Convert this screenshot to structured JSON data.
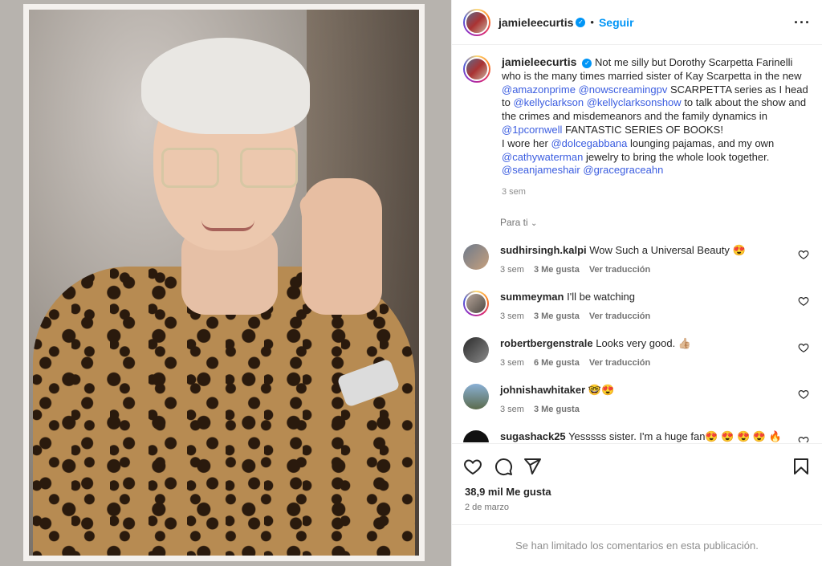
{
  "post": {
    "username": "jamieleecurtis",
    "verified": true,
    "follow_label": "Seguir",
    "caption_parts": {
      "p1": "Not me silly but Dorothy Scarpetta Farinelli who is the many times married sister of Kay Scarpetta in the new",
      "m1": "@amazonprime",
      "m2": "@nowscreamingpv",
      "p2": "SCARPETTA series as I head to",
      "m3": "@kellyclarkson",
      "m4": "@kellyclarksonshow",
      "p3": "to talk about the show and the crimes and misdemeanors and the family dynamics in",
      "m5": "@1pcornwell",
      "p4": "FANTASTIC SERIES OF BOOKS!",
      "p5": "I wore her",
      "m6": "@dolcegabbana",
      "p6": "lounging pajamas, and my own",
      "m7": "@cathywaterman",
      "p7": "jewelry to bring the whole look together.",
      "m8": "@seanjameshair",
      "m9": "@gracegraceahn"
    },
    "caption_time": "3 sem",
    "for_you_label": "Para ti",
    "likes": "38,9 mil Me gusta",
    "date": "2 de marzo",
    "limited_notice": "Se han limitado los comentarios en esta publicación."
  },
  "comments": [
    {
      "user": "sudhirsingh.kalpi",
      "text": "Wow Such a Universal Beauty 😍",
      "time": "3 sem",
      "likes": "3 Me gusta",
      "translate": "Ver traducción"
    },
    {
      "user": "summeyman",
      "text": "I'll be watching",
      "time": "3 sem",
      "likes": "3 Me gusta",
      "translate": "Ver traducción"
    },
    {
      "user": "robertbergenstrale",
      "text": "Looks very good. 👍🏼",
      "time": "3 sem",
      "likes": "6 Me gusta",
      "translate": "Ver traducción"
    },
    {
      "user": "johnishawhitaker",
      "text": "🤓😍",
      "time": "3 sem",
      "likes": "3 Me gusta"
    },
    {
      "user": "sugashack25",
      "text": "Yesssss sister. I'm a huge fan😍 😍 😍 😍 🔥"
    }
  ],
  "icons": {
    "more": "more-options-icon",
    "like": "heart-icon",
    "comment": "comment-icon",
    "share": "send-icon",
    "save": "bookmark-icon"
  },
  "colors": {
    "link": "#0095f6",
    "mention": "#3b5de0",
    "muted": "#737373"
  }
}
